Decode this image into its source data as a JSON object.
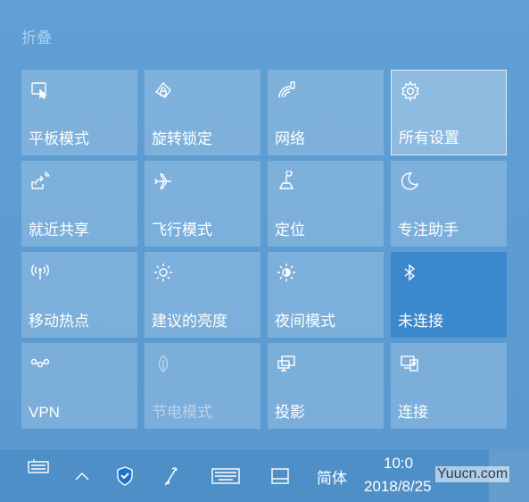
{
  "panel": {
    "collapse_label": "折叠",
    "tiles": [
      {
        "label": "平板模式",
        "icon": "tablet-mode-icon",
        "state": "normal"
      },
      {
        "label": "旋转锁定",
        "icon": "rotation-lock-icon",
        "state": "normal"
      },
      {
        "label": "网络",
        "icon": "network-icon",
        "state": "normal"
      },
      {
        "label": "所有设置",
        "icon": "gear-icon",
        "state": "hovered"
      },
      {
        "label": "就近共享",
        "icon": "nearby-share-icon",
        "state": "normal"
      },
      {
        "label": "飞行模式",
        "icon": "airplane-icon",
        "state": "normal"
      },
      {
        "label": "定位",
        "icon": "location-icon",
        "state": "normal"
      },
      {
        "label": "专注助手",
        "icon": "moon-icon",
        "state": "normal"
      },
      {
        "label": "移动热点",
        "icon": "hotspot-icon",
        "state": "normal"
      },
      {
        "label": "建议的亮度",
        "icon": "brightness-icon",
        "state": "normal"
      },
      {
        "label": "夜间模式",
        "icon": "night-light-icon",
        "state": "normal"
      },
      {
        "label": "未连接",
        "icon": "bluetooth-icon",
        "state": "active"
      },
      {
        "label": "VPN",
        "icon": "vpn-icon",
        "state": "normal"
      },
      {
        "label": "节电模式",
        "icon": "battery-saver-icon",
        "state": "disabled"
      },
      {
        "label": "投影",
        "icon": "project-icon",
        "state": "normal"
      },
      {
        "label": "连接",
        "icon": "connect-icon",
        "state": "normal"
      }
    ]
  },
  "taskbar": {
    "ime_label": "简体",
    "time": "10:0",
    "date": "2018/8/25",
    "watermark": "Yuucn.com",
    "icons": [
      "touch-keyboard-icon",
      "show-hidden-icons-chevron-icon",
      "shield-icon",
      "pen-icon",
      "keyboard-icon",
      "tablet-icon"
    ]
  },
  "colors": {
    "panel_bg": "#5a9bd0",
    "tile_bg": "rgba(255,255,255,0.20)",
    "active_tile_bg": "#3b88cc",
    "collapse_text": "#a9d0f5",
    "taskbar_bg": "#4f8fc7"
  }
}
